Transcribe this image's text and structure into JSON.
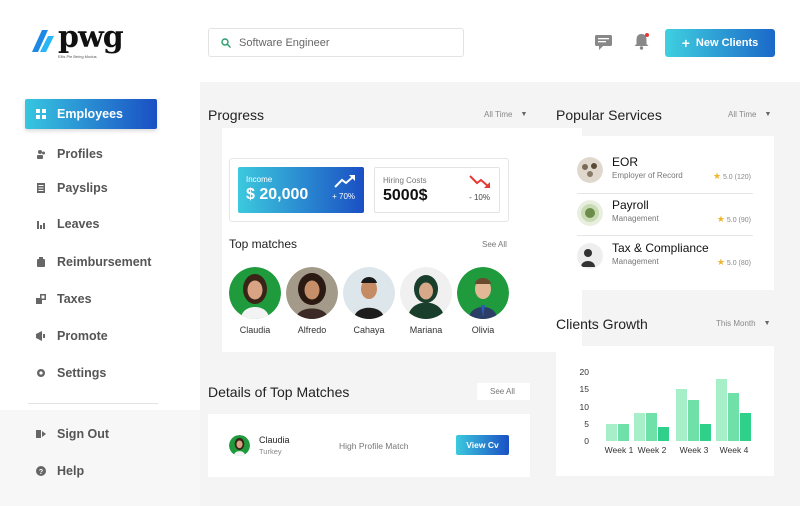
{
  "brand": {
    "name": "pwg",
    "tagline": "Ellis Pie Being Modus"
  },
  "colors": {
    "accent_start": "#37c6e0",
    "accent_end": "#1a4fc4",
    "bar_light": "#a6efc8",
    "bar_dark": "#2fd08a"
  },
  "sidebar": {
    "items": [
      {
        "label": "Employees",
        "icon": "grid-icon",
        "active": true
      },
      {
        "label": "Profiles",
        "icon": "users-icon"
      },
      {
        "label": "Payslips",
        "icon": "document-icon"
      },
      {
        "label": "Leaves",
        "icon": "bar-chart-icon"
      },
      {
        "label": "Reimbursement",
        "icon": "wallet-icon"
      },
      {
        "label": "Taxes",
        "icon": "tax-icon"
      },
      {
        "label": "Promote",
        "icon": "megaphone-icon"
      },
      {
        "label": "Settings",
        "icon": "gear-icon"
      }
    ],
    "bottom": [
      {
        "label": "Sign Out",
        "icon": "sign-out-icon"
      },
      {
        "label": "Help",
        "icon": "help-icon"
      }
    ]
  },
  "topbar": {
    "search_placeholder": "Software Engineer",
    "new_button": "New Clients"
  },
  "progress": {
    "title": "Progress",
    "filter": "All Time",
    "income": {
      "label": "Income",
      "value": "$ 20,000",
      "change": "+ 70%"
    },
    "hiring": {
      "label": "Hiring Costs",
      "value": "5000$",
      "change": "- 10%"
    },
    "top_matches_title": "Top matches",
    "see_all": "See All",
    "matches": [
      "Claudia",
      "Alfredo",
      "Cahaya",
      "Mariana",
      "Olivia"
    ]
  },
  "details": {
    "title": "Details of Top Matches",
    "see_all": "See All",
    "row": {
      "name": "Claudia",
      "country": "Turkey",
      "tag": "High Profile Match",
      "button": "View Cv"
    }
  },
  "services": {
    "title": "Popular Services",
    "filter": "All Time",
    "items": [
      {
        "title": "EOR",
        "subtitle": "Employer of Record",
        "rating": "5.0",
        "count": "(120)"
      },
      {
        "title": "Payroll",
        "subtitle": "Management",
        "rating": "5.0",
        "count": "(90)"
      },
      {
        "title": "Tax & Compliance",
        "subtitle": "Management",
        "rating": "5.0",
        "count": "(80)"
      }
    ]
  },
  "growth": {
    "title": "Clients Growth",
    "filter": "This Month"
  },
  "chart_data": {
    "type": "bar",
    "categories": [
      "Week 1",
      "Week 2",
      "Week 3",
      "Week 4"
    ],
    "series": [
      {
        "values": [
          5,
          8,
          15,
          18
        ],
        "color": "#a6efc8"
      },
      {
        "values": [
          5,
          8,
          12,
          14
        ],
        "color": "#6fe0a8"
      },
      {
        "values": [
          null,
          4,
          5,
          8
        ],
        "color": "#2fd08a"
      }
    ],
    "yticks": [
      "0",
      "5",
      "10",
      "15",
      "20"
    ],
    "ylim": [
      0,
      20
    ]
  }
}
